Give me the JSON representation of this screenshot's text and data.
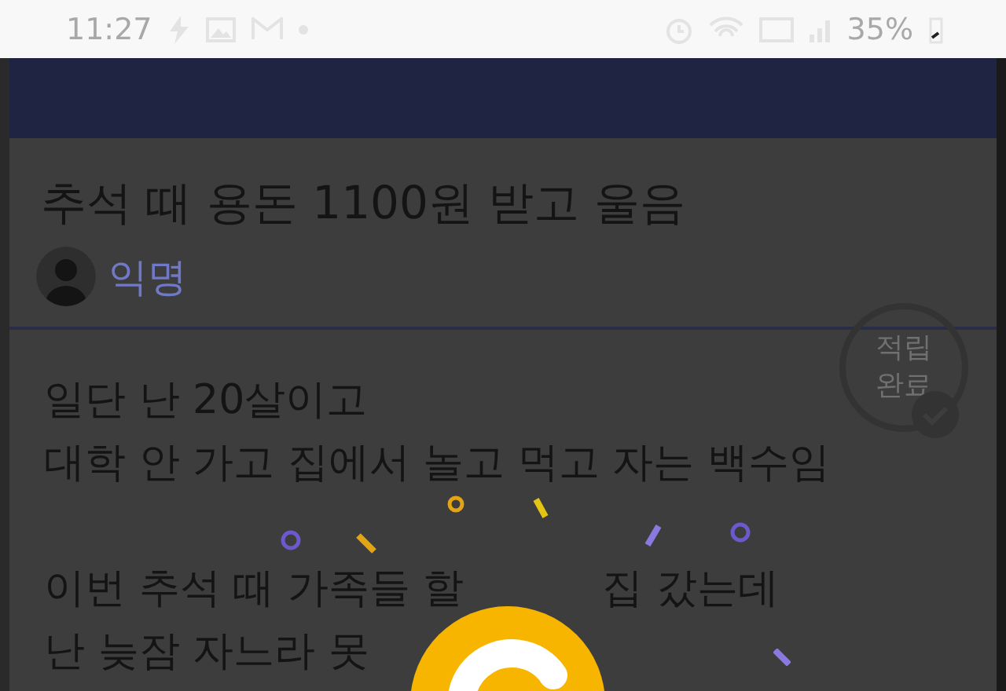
{
  "status_bar": {
    "time": "11:27",
    "battery": "35%"
  },
  "post": {
    "title": "추석 때 용돈 1100원 받고 울음",
    "author": "익명",
    "stamp": [
      "적립",
      "완료"
    ],
    "paragraphs": [
      [
        [
          "일단 난 20살이고"
        ],
        [
          "대학 안 가고 집에서 놀고 먹고 자는 백수임"
        ]
      ],
      [
        [
          "이번 추석 때 가족들 할",
          "집 갔는데"
        ],
        [
          "난 늦잠 자느라 못"
        ]
      ]
    ]
  }
}
